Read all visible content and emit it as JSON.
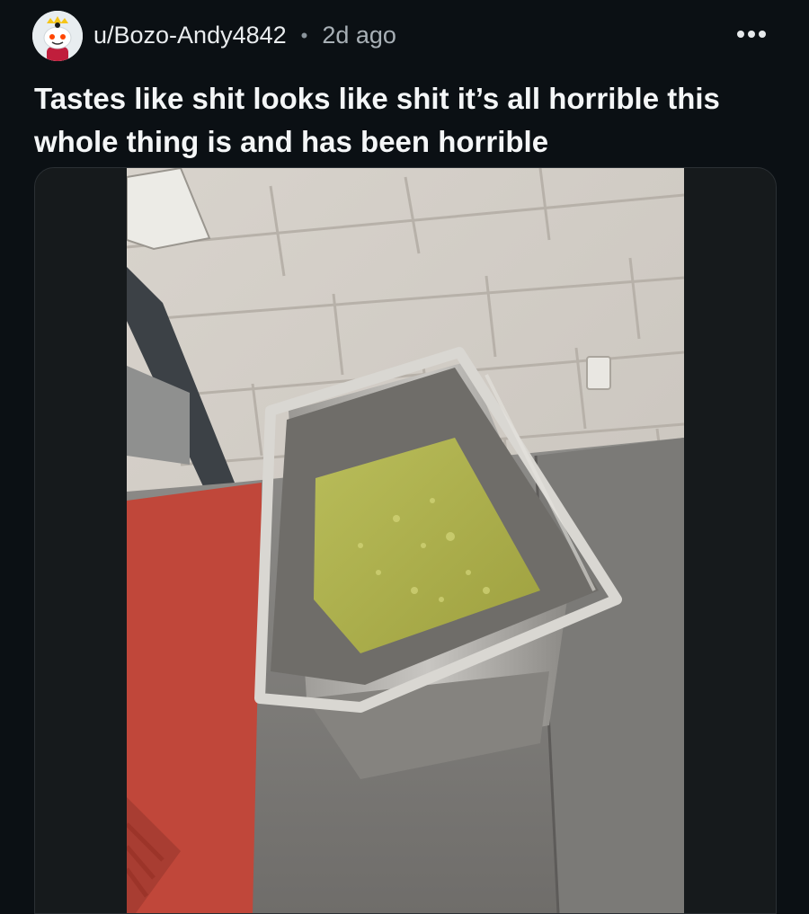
{
  "post": {
    "username": "u/Bozo-Andy4842",
    "separator": "•",
    "age": "2d ago",
    "more_icon": "ellipsis-icon",
    "title": "Tastes like shit looks like shit it’s all horrible this whole thing is and has been horrible",
    "avatar_icon": "snoo-avatar-icon",
    "media_icon": "photo"
  }
}
